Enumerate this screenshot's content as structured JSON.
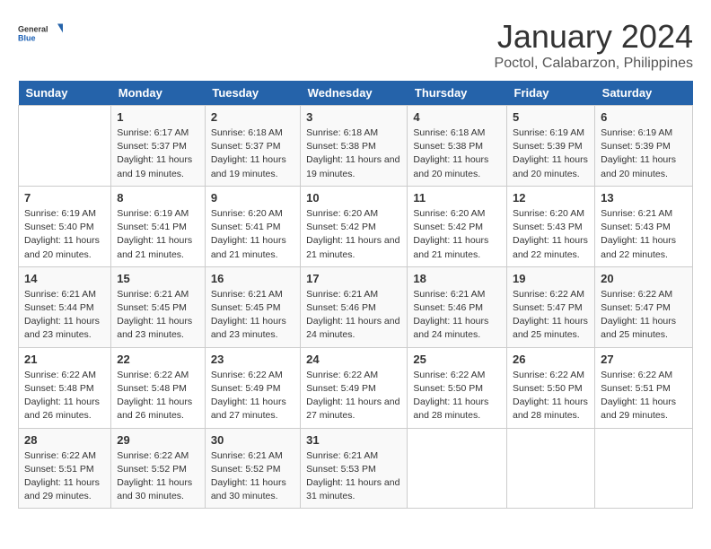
{
  "logo": {
    "text_general": "General",
    "text_blue": "Blue"
  },
  "title": "January 2024",
  "subtitle": "Poctol, Calabarzon, Philippines",
  "days_of_week": [
    "Sunday",
    "Monday",
    "Tuesday",
    "Wednesday",
    "Thursday",
    "Friday",
    "Saturday"
  ],
  "weeks": [
    [
      {
        "day": "",
        "sunrise": "",
        "sunset": "",
        "daylight": ""
      },
      {
        "day": "1",
        "sunrise": "6:17 AM",
        "sunset": "5:37 PM",
        "daylight": "11 hours and 19 minutes."
      },
      {
        "day": "2",
        "sunrise": "6:18 AM",
        "sunset": "5:37 PM",
        "daylight": "11 hours and 19 minutes."
      },
      {
        "day": "3",
        "sunrise": "6:18 AM",
        "sunset": "5:38 PM",
        "daylight": "11 hours and 19 minutes."
      },
      {
        "day": "4",
        "sunrise": "6:18 AM",
        "sunset": "5:38 PM",
        "daylight": "11 hours and 20 minutes."
      },
      {
        "day": "5",
        "sunrise": "6:19 AM",
        "sunset": "5:39 PM",
        "daylight": "11 hours and 20 minutes."
      },
      {
        "day": "6",
        "sunrise": "6:19 AM",
        "sunset": "5:39 PM",
        "daylight": "11 hours and 20 minutes."
      }
    ],
    [
      {
        "day": "7",
        "sunrise": "6:19 AM",
        "sunset": "5:40 PM",
        "daylight": "11 hours and 20 minutes."
      },
      {
        "day": "8",
        "sunrise": "6:19 AM",
        "sunset": "5:41 PM",
        "daylight": "11 hours and 21 minutes."
      },
      {
        "day": "9",
        "sunrise": "6:20 AM",
        "sunset": "5:41 PM",
        "daylight": "11 hours and 21 minutes."
      },
      {
        "day": "10",
        "sunrise": "6:20 AM",
        "sunset": "5:42 PM",
        "daylight": "11 hours and 21 minutes."
      },
      {
        "day": "11",
        "sunrise": "6:20 AM",
        "sunset": "5:42 PM",
        "daylight": "11 hours and 21 minutes."
      },
      {
        "day": "12",
        "sunrise": "6:20 AM",
        "sunset": "5:43 PM",
        "daylight": "11 hours and 22 minutes."
      },
      {
        "day": "13",
        "sunrise": "6:21 AM",
        "sunset": "5:43 PM",
        "daylight": "11 hours and 22 minutes."
      }
    ],
    [
      {
        "day": "14",
        "sunrise": "6:21 AM",
        "sunset": "5:44 PM",
        "daylight": "11 hours and 23 minutes."
      },
      {
        "day": "15",
        "sunrise": "6:21 AM",
        "sunset": "5:45 PM",
        "daylight": "11 hours and 23 minutes."
      },
      {
        "day": "16",
        "sunrise": "6:21 AM",
        "sunset": "5:45 PM",
        "daylight": "11 hours and 23 minutes."
      },
      {
        "day": "17",
        "sunrise": "6:21 AM",
        "sunset": "5:46 PM",
        "daylight": "11 hours and 24 minutes."
      },
      {
        "day": "18",
        "sunrise": "6:21 AM",
        "sunset": "5:46 PM",
        "daylight": "11 hours and 24 minutes."
      },
      {
        "day": "19",
        "sunrise": "6:22 AM",
        "sunset": "5:47 PM",
        "daylight": "11 hours and 25 minutes."
      },
      {
        "day": "20",
        "sunrise": "6:22 AM",
        "sunset": "5:47 PM",
        "daylight": "11 hours and 25 minutes."
      }
    ],
    [
      {
        "day": "21",
        "sunrise": "6:22 AM",
        "sunset": "5:48 PM",
        "daylight": "11 hours and 26 minutes."
      },
      {
        "day": "22",
        "sunrise": "6:22 AM",
        "sunset": "5:48 PM",
        "daylight": "11 hours and 26 minutes."
      },
      {
        "day": "23",
        "sunrise": "6:22 AM",
        "sunset": "5:49 PM",
        "daylight": "11 hours and 27 minutes."
      },
      {
        "day": "24",
        "sunrise": "6:22 AM",
        "sunset": "5:49 PM",
        "daylight": "11 hours and 27 minutes."
      },
      {
        "day": "25",
        "sunrise": "6:22 AM",
        "sunset": "5:50 PM",
        "daylight": "11 hours and 28 minutes."
      },
      {
        "day": "26",
        "sunrise": "6:22 AM",
        "sunset": "5:50 PM",
        "daylight": "11 hours and 28 minutes."
      },
      {
        "day": "27",
        "sunrise": "6:22 AM",
        "sunset": "5:51 PM",
        "daylight": "11 hours and 29 minutes."
      }
    ],
    [
      {
        "day": "28",
        "sunrise": "6:22 AM",
        "sunset": "5:51 PM",
        "daylight": "11 hours and 29 minutes."
      },
      {
        "day": "29",
        "sunrise": "6:22 AM",
        "sunset": "5:52 PM",
        "daylight": "11 hours and 30 minutes."
      },
      {
        "day": "30",
        "sunrise": "6:21 AM",
        "sunset": "5:52 PM",
        "daylight": "11 hours and 30 minutes."
      },
      {
        "day": "31",
        "sunrise": "6:21 AM",
        "sunset": "5:53 PM",
        "daylight": "11 hours and 31 minutes."
      },
      {
        "day": "",
        "sunrise": "",
        "sunset": "",
        "daylight": ""
      },
      {
        "day": "",
        "sunrise": "",
        "sunset": "",
        "daylight": ""
      },
      {
        "day": "",
        "sunrise": "",
        "sunset": "",
        "daylight": ""
      }
    ]
  ]
}
